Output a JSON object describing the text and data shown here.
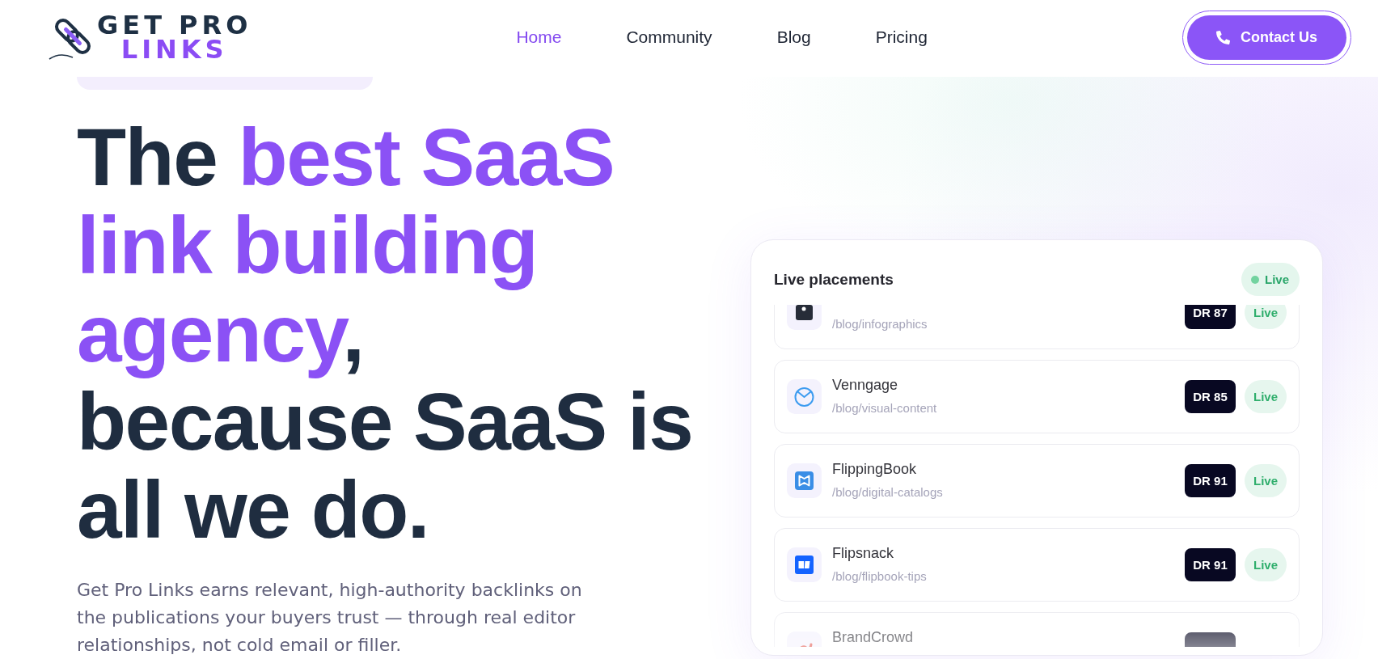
{
  "header": {
    "logo": {
      "lines": [
        {
          "text": "GET PRO",
          "highlight": false
        },
        {
          "text": "LINKS",
          "highlight": true
        }
      ]
    },
    "nav": [
      {
        "label": "Home",
        "selected": true
      },
      {
        "label": "Community",
        "selected": false
      },
      {
        "label": "Blog",
        "selected": false
      },
      {
        "label": "Pricing",
        "selected": false
      }
    ],
    "cta": {
      "label": "Contact Us"
    }
  },
  "hero": {
    "headline": [
      [
        {
          "text": "The ",
          "highlight": false
        },
        {
          "text": "best SaaS",
          "highlight": true
        }
      ],
      [
        {
          "text": "link building",
          "highlight": true
        }
      ],
      [
        {
          "text": "agency",
          "highlight": true
        },
        {
          "text": ",",
          "highlight": false
        }
      ],
      [
        {
          "text": "because SaaS is",
          "highlight": false
        }
      ],
      [
        {
          "text": "all we do.",
          "highlight": false
        }
      ]
    ],
    "description": "Get Pro Links earns relevant, high-authority backlinks on the publications your buyers trust — through real editor relationships, not cold email or filler."
  },
  "placements": {
    "title": "Live placements",
    "status": "Live",
    "rows": [
      {
        "path": "/blog/infographics",
        "rating": "DR 87",
        "status": "Live"
      },
      {
        "name": "Venngage",
        "path": "/blog/visual-content",
        "rating": "DR 85",
        "status": "Live"
      },
      {
        "name": "FlippingBook",
        "path": "/blog/digital-catalogs",
        "rating": "DR 91",
        "status": "Live"
      },
      {
        "name": "Flipsnack",
        "path": "/blog/flipbook-tips",
        "rating": "DR 91",
        "status": "Live"
      },
      {
        "name": "BrandCrowd"
      }
    ]
  }
}
